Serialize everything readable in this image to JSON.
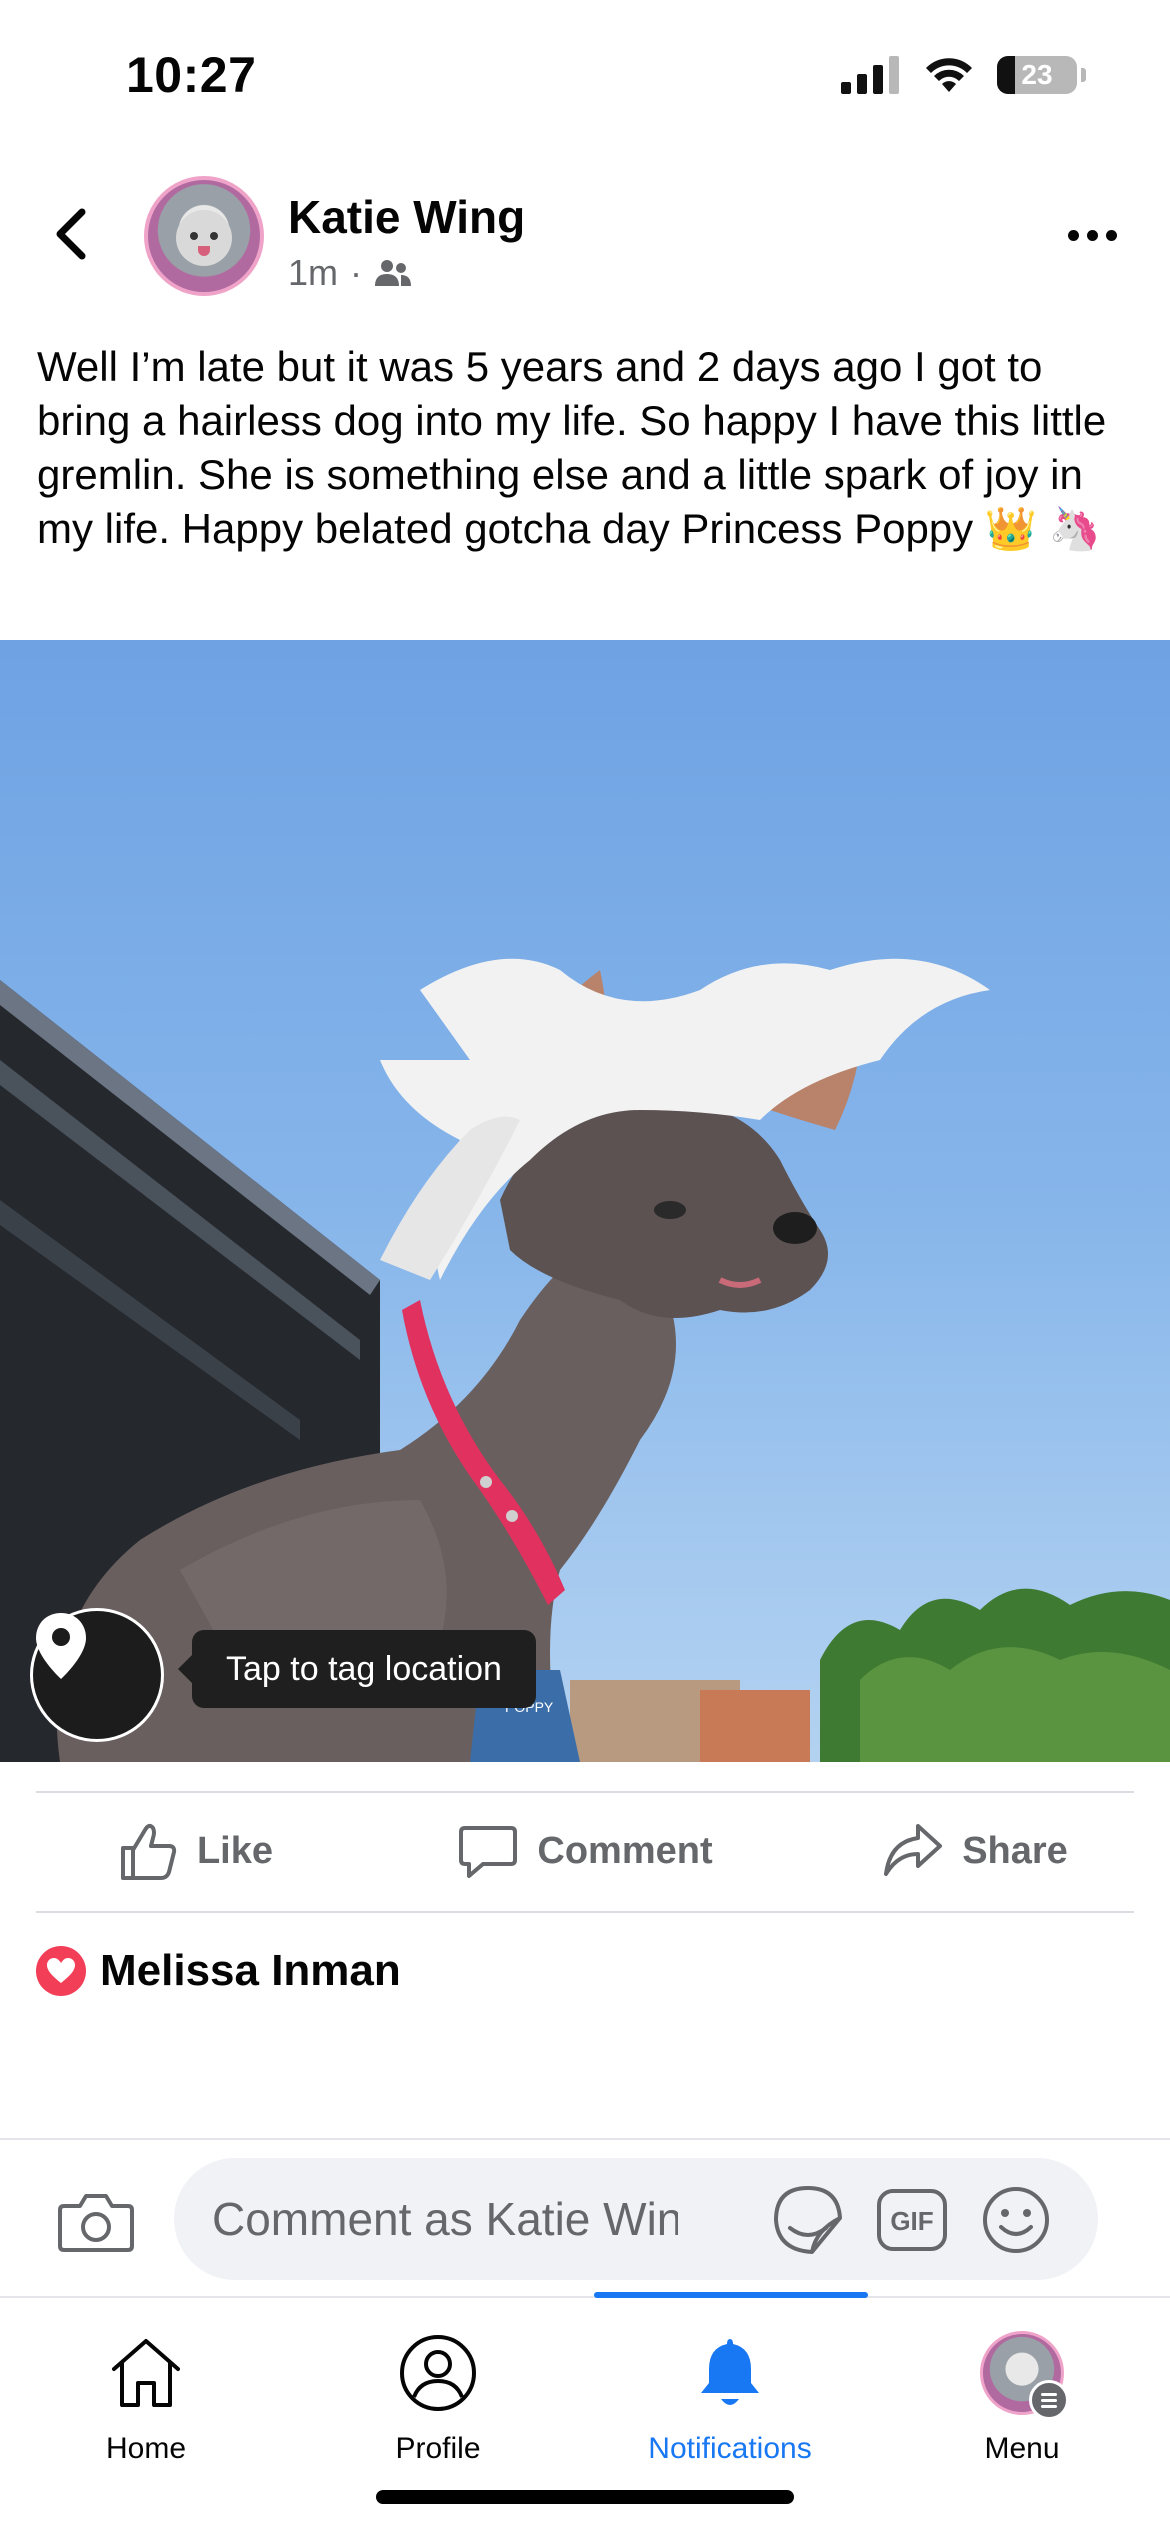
{
  "status_bar": {
    "time": "10:27",
    "battery_level": "23",
    "battery_fraction": 0.23,
    "icons": [
      "signal-icon",
      "wifi-icon",
      "battery-icon"
    ]
  },
  "post": {
    "author": "Katie Wing",
    "timestamp": "1m",
    "separator": "·",
    "audience_icon": "friends-icon",
    "text": "Well I’m late but it was 5 years and 2 days ago I got to bring a hairless dog into my life. So happy I have this little gremlin. She is something else and a little spark of joy in my life. Happy belated gotcha day Princess Poppy 👑 🦄",
    "photo": {
      "tag_location_label": "Tap to tag location",
      "collar_tag_text": "POPPY"
    }
  },
  "actions": {
    "like": "Like",
    "comment": "Comment",
    "share": "Share"
  },
  "reactions": {
    "icon": "love-reaction-icon",
    "names": "Melissa Inman"
  },
  "composer": {
    "placeholder": "Comment as Katie Wing",
    "icons": [
      "camera-icon",
      "sticker-icon",
      "gif-icon",
      "emoji-icon"
    ],
    "gif_label": "GIF"
  },
  "tabbar": {
    "tabs": [
      {
        "label": "Home",
        "icon": "home-icon",
        "active": false
      },
      {
        "label": "Profile",
        "icon": "profile-icon",
        "active": false
      },
      {
        "label": "Notifications",
        "icon": "bell-icon",
        "active": true
      },
      {
        "label": "Menu",
        "icon": "menu-avatar",
        "active": false
      }
    ]
  },
  "colors": {
    "accent": "#1877f2",
    "secondary_text": "#65676b",
    "love_reaction": "#f33e58",
    "collar": "#e0315f"
  }
}
